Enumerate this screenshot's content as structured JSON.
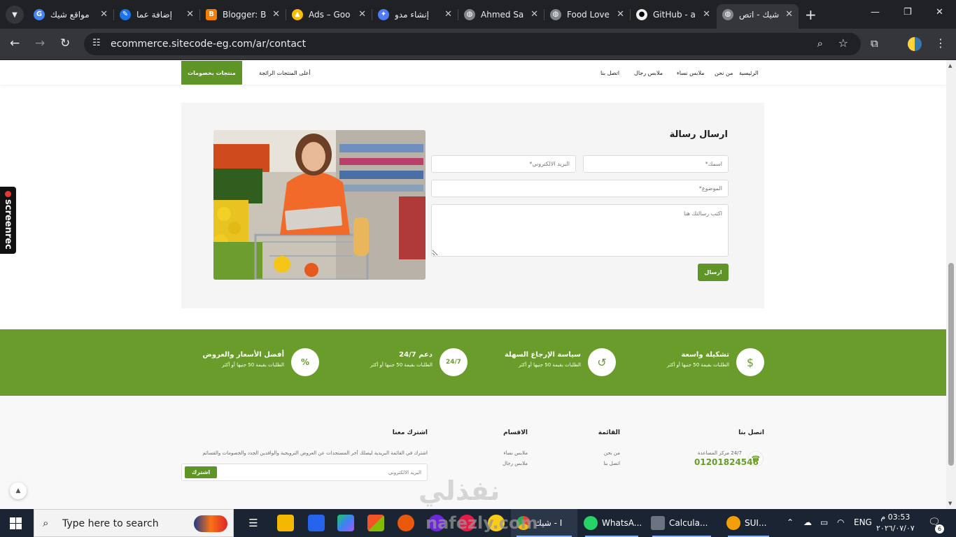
{
  "browser": {
    "tabs": [
      {
        "title": "مواقع شيك",
        "favicon": "google-icon",
        "color": "#4285f4"
      },
      {
        "title": "إضافة عما",
        "favicon": "edit-icon",
        "color": "#1a73e8"
      },
      {
        "title": "Blogger: B",
        "favicon": "blogger-icon",
        "color": "#f57d00"
      },
      {
        "title": "Ads – Goo",
        "favicon": "google-ads-icon",
        "color": "#fbbc04"
      },
      {
        "title": "إنشاء مدو",
        "favicon": "gemini-icon",
        "color": "#4e7cf6"
      },
      {
        "title": "Ahmed Sa",
        "favicon": "globe-icon",
        "color": "#80868b"
      },
      {
        "title": "Food Love",
        "favicon": "globe-icon",
        "color": "#80868b"
      },
      {
        "title": "GitHub - a",
        "favicon": "github-icon",
        "color": "#f0f0f0"
      },
      {
        "title": "شيك - اتص",
        "favicon": "globe-icon",
        "color": "#80868b"
      }
    ],
    "url": "ecommerce.sitecode-eg.com/ar/contact"
  },
  "nav": {
    "links": [
      "الرئيسية",
      "من نحن",
      "ملابس نساء",
      "ملابس رجال",
      "اتصل بنا"
    ],
    "top_products": "أعلى المنتجات الرائجة",
    "deals": "منتجات بخصومات"
  },
  "contact_form": {
    "title": "ارسال رسالة",
    "name_placeholder": "اسمك*",
    "email_placeholder": "البريد الالكتروني*",
    "subject_placeholder": "الموضوع*",
    "message_placeholder": "اكتب رسالتك هنا",
    "send": "ارسال"
  },
  "features": [
    {
      "title": "تشكيلة واسعة",
      "sub": "الطلبات بقيمة 50 جنيها أو أكثر",
      "icon": "dollar-icon"
    },
    {
      "title": "سياسة الإرجاع السهلة",
      "sub": "الطلبات بقيمة 50 جنيها أو أكثر",
      "icon": "return-icon"
    },
    {
      "title": "دعم 24/7",
      "sub": "الطلبات بقيمة 50 جنيها أو أكثر",
      "icon": "support-24-7-icon"
    },
    {
      "title": "أفضل الأسعار والعروض",
      "sub": "الطلبات بقيمة 50 جنيها أو أكثر",
      "icon": "discount-icon"
    }
  ],
  "footer": {
    "contact_title": "اتصل بنا",
    "help_center": "24/7 مركز المساعدة",
    "phone": "01201824546",
    "menu_title": "القائمة",
    "menu_links": [
      "من نحن",
      "اتصل بنا"
    ],
    "categories_title": "الاقسام",
    "categories_links": [
      "ملابس نساء",
      "ملابس رجال"
    ],
    "subscribe_title": "اشترك معنا",
    "subscribe_desc": "اشترك في القائمة البريدية ليصلك آخر المستجدات عن العروض الترويجية والوافدين الجدد والخصومات والقسائم",
    "email_placeholder": "البريد الالكتروني",
    "subscribe_btn": "اشترك"
  },
  "overlays": {
    "screenrec": "screenrec",
    "watermark_ar": "نفذلي",
    "watermark_en": "nafezly.com"
  },
  "taskbar": {
    "search": "Type here to search",
    "apps": [
      {
        "label": "شيك - I",
        "color": "#e8a33d"
      },
      {
        "label": "WhatsA...",
        "color": "#25d366"
      },
      {
        "label": "Calcula...",
        "color": "#6b7280"
      },
      {
        "label": "SUI...",
        "color": "#f59e0b"
      }
    ],
    "lang": "ENG",
    "time": "03:53 م",
    "date": "٢٠٢٦/٠٧/٠٧",
    "notifications": "6"
  }
}
